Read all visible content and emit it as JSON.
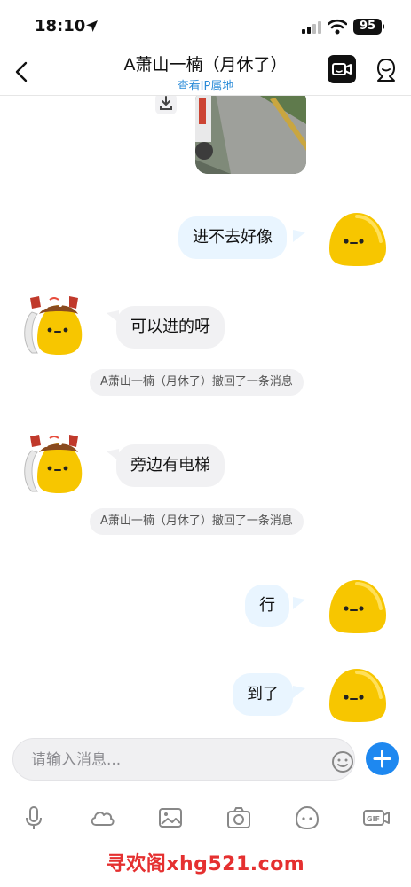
{
  "status": {
    "time": "18:10",
    "battery": "95"
  },
  "header": {
    "title": "A萧山一楠（月休了）",
    "subtitle": "查看IP属地"
  },
  "messages": [
    {
      "side": "out",
      "text": "进不去好像"
    },
    {
      "side": "in",
      "text": "可以进的呀"
    },
    {
      "side": "system",
      "text": "A萧山一楠（月休了）撤回了一条消息"
    },
    {
      "side": "in",
      "text": "旁边有电梯"
    },
    {
      "side": "system",
      "text": "A萧山一楠（月休了）撤回了一条消息"
    },
    {
      "side": "out",
      "text": "行"
    },
    {
      "side": "out",
      "text": "到了"
    }
  ],
  "composer": {
    "placeholder": "请输入消息..."
  },
  "toolbar": [
    "mic-icon",
    "cloud-icon",
    "image-icon",
    "camera-icon",
    "emoji-face-icon",
    "gif-icon"
  ],
  "watermark": "寻欢阁xhg521.com",
  "colors": {
    "accent": "#1e88f0",
    "out_bubble": "#e9f5ff",
    "in_bubble": "#f1f1f3",
    "watermark": "#e53030"
  }
}
